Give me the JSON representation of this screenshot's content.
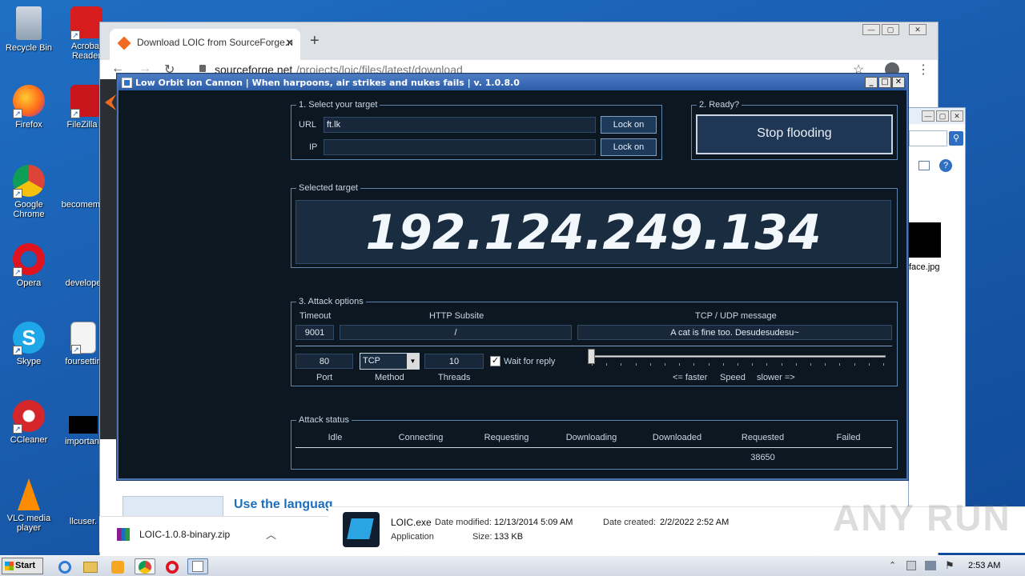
{
  "desktop": {
    "icons": [
      {
        "label": "Recycle Bin"
      },
      {
        "label": "Acrobat Reader"
      },
      {
        "label": "Firefox"
      },
      {
        "label": "FileZilla C"
      },
      {
        "label": "Google Chrome"
      },
      {
        "label": "becomeme"
      },
      {
        "label": "Opera"
      },
      {
        "label": "develope"
      },
      {
        "label": "Skype"
      },
      {
        "label": "foursettin"
      },
      {
        "label": "CCleaner"
      },
      {
        "label": "important"
      },
      {
        "label": "VLC media player"
      },
      {
        "label": "llcuser."
      }
    ]
  },
  "chrome": {
    "tab_title": "Download LOIC from SourceForge.n",
    "url_host": "sourceforge.net",
    "url_path": "/projects/loic/files/latest/download",
    "page_snippet": "Use the languag",
    "download_file": "LOIC-1.0.8-binary.zip"
  },
  "loic": {
    "title": "Low Orbit Ion Cannon | When harpoons, air strikes and nukes fails | v. 1.0.8.0",
    "select_target": {
      "label": "1. Select your target",
      "url_label": "URL",
      "url_value": "ft.lk",
      "ip_label": "IP",
      "ip_value": "",
      "lock_url": "Lock on",
      "lock_ip": "Lock on"
    },
    "ready": {
      "label": "2. Ready?",
      "button": "Stop flooding"
    },
    "selected_target": {
      "label": "Selected target",
      "ip": "192.124.249.134"
    },
    "attack_options": {
      "label": "3. Attack options",
      "timeout_label": "Timeout",
      "timeout_value": "9001",
      "subsite_label": "HTTP Subsite",
      "subsite_value": "/",
      "message_label": "TCP / UDP message",
      "message_value": "A cat is fine too. Desudesudesu~",
      "port_value": "80",
      "port_label": "Port",
      "method_value": "TCP",
      "method_label": "Method",
      "threads_value": "10",
      "threads_label": "Threads",
      "wait_label": "Wait for reply",
      "wait_checked": true,
      "speed_faster": "<= faster",
      "speed_label": "Speed",
      "speed_slower": "slower =>",
      "speed_level": 0
    },
    "attack_status": {
      "label": "Attack status",
      "columns": [
        "Idle",
        "Connecting",
        "Requesting",
        "Downloading",
        "Downloaded",
        "Requested",
        "Failed"
      ],
      "values": [
        "",
        "",
        "",
        "",
        "",
        "38650",
        ""
      ]
    }
  },
  "explorer": {
    "file_label": "face.jpg"
  },
  "file_details": {
    "name": "LOIC.exe",
    "type": "Application",
    "modified_label": "Date modified:",
    "modified_value": "12/13/2014 5:09 AM",
    "created_label": "Date created:",
    "created_value": "2/2/2022 2:52 AM",
    "size_label": "Size:",
    "size_value": "133 KB"
  },
  "taskbar": {
    "start_label": "Start",
    "clock": "2:53 AM"
  },
  "watermark": "ANY RUN"
}
